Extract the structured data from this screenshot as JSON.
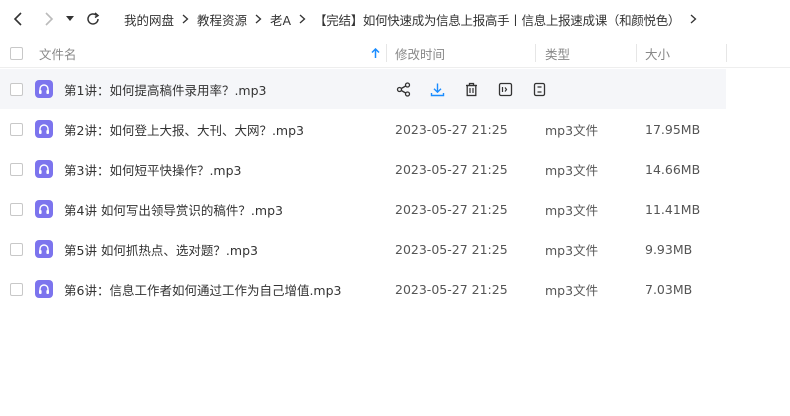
{
  "breadcrumbs": [
    "我的网盘",
    "教程资源",
    "老A",
    "【完结】如何快速成为信息上报高手丨信息上报速成课（和颜悦色）"
  ],
  "columns": {
    "name": "文件名",
    "modified": "修改时间",
    "type": "类型",
    "size": "大小"
  },
  "files": [
    {
      "name": "第1讲：如何提高稿件录用率？.mp3",
      "modified": "",
      "type": "",
      "size": ""
    },
    {
      "name": "第2讲：如何登上大报、大刊、大网？.mp3",
      "modified": "2023-05-27 21:25",
      "type": "mp3文件",
      "size": "17.95MB"
    },
    {
      "name": "第3讲：如何短平快操作？.mp3",
      "modified": "2023-05-27 21:25",
      "type": "mp3文件",
      "size": "14.66MB"
    },
    {
      "name": "第4讲 如何写出领导赏识的稿件？.mp3",
      "modified": "2023-05-27 21:25",
      "type": "mp3文件",
      "size": "11.41MB"
    },
    {
      "name": "第5讲 如何抓热点、选对题？.mp3",
      "modified": "2023-05-27 21:25",
      "type": "mp3文件",
      "size": "9.93MB"
    },
    {
      "name": "第6讲：信息工作者如何通过工作为自己增值.mp3",
      "modified": "2023-05-27 21:25",
      "type": "mp3文件",
      "size": "7.03MB"
    }
  ],
  "hover_actions": [
    "share-icon",
    "download-icon",
    "delete-icon",
    "rename-icon",
    "more-icon"
  ],
  "colors": {
    "accent": "#1a8cff",
    "file_icon": "#7c74ee",
    "hover_row": "#f5f6f9"
  }
}
